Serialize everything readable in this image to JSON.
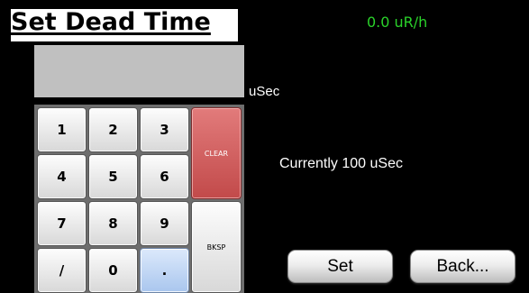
{
  "header": {
    "title": "Set Dead Time",
    "rate_reading": "0.0 uR/h"
  },
  "entry": {
    "value": "",
    "unit": "uSec"
  },
  "keypad": {
    "keys": {
      "k1": "1",
      "k2": "2",
      "k3": "3",
      "k4": "4",
      "k5": "5",
      "k6": "6",
      "k7": "7",
      "k8": "8",
      "k9": "9",
      "slash": "/",
      "k0": "0",
      "dot": ".",
      "clear": "CLEAR",
      "bksp": "BKSP"
    }
  },
  "status": {
    "current": "Currently 100 uSec"
  },
  "actions": {
    "set": "Set",
    "back": "Back..."
  },
  "colors": {
    "background": "#000000",
    "rate_text": "#2ad22a",
    "clear_key": "#d05a5a",
    "dot_key": "#bcd4f3",
    "display_field": "#c0c0c0"
  }
}
